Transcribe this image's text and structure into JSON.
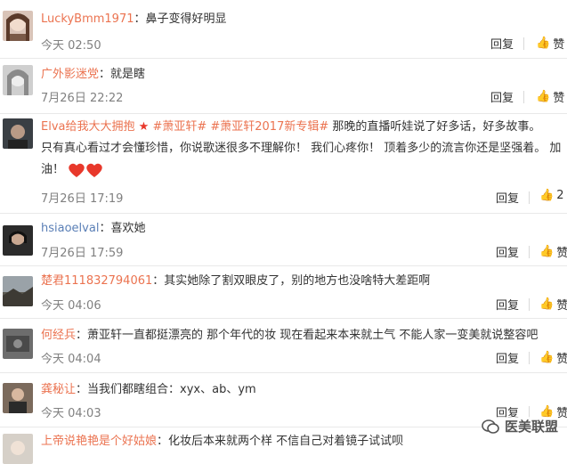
{
  "comments": [
    {
      "user": "LuckyBmm1971",
      "sep": "：",
      "text": "鼻子变得好明显",
      "time": "今天 02:50",
      "reply": "回复",
      "like": "赞"
    },
    {
      "user": "广外影迷党",
      "sep": "：",
      "text": "就是瞎",
      "time": "7月26日 22:22",
      "reply": "回复",
      "like": "赞"
    },
    {
      "user": "Elva给我大大拥抱",
      "topic1": "#萧亚轩#",
      "topic2": "#萧亚轩2017新专辑#",
      "text_line1": " 那晚的直播听娃说了好多话，好多故事。",
      "text_line2": "只有真心看过才会懂珍惜，你说歌迷很多不理解你！  我们心疼你！  顶着多少的流言你还是坚强着。 加油！",
      "time": "7月26日 17:19",
      "reply": "回复",
      "like_count": "2"
    },
    {
      "user": "hsiaoelval",
      "sep": "：",
      "text": "喜欢她",
      "time": "7月26日 17:59",
      "reply": "回复",
      "like": "赞"
    },
    {
      "user": "楚君111832794061",
      "sep": "：",
      "text": "其实她除了割双眼皮了，别的地方也没啥特大差距啊",
      "time": "今天 04:06",
      "reply": "回复",
      "like": "赞"
    },
    {
      "user": "何经兵",
      "sep": "：",
      "text": "萧亚轩一直都挺漂亮的 那个年代的妆 现在看起来本来就土气 不能人家一变美就说整容吧",
      "time": "今天 04:04",
      "reply": "回复",
      "like": "赞"
    },
    {
      "user": "龚秘让",
      "sep": "：",
      "text": "当我们都瞎组合：xyx、ab、ym",
      "time": "今天 04:03",
      "reply": "回复",
      "like": "赞"
    },
    {
      "user": "上帝说艳艳是个好姑娘",
      "sep": "：",
      "text": "化妆后本来就两个样  不信自己对着镜子试试呗"
    }
  ],
  "watermark": {
    "text": "医美联盟"
  },
  "colors": {
    "username": "#eb7350",
    "time": "#808080",
    "divider": "#e9e9e9"
  }
}
